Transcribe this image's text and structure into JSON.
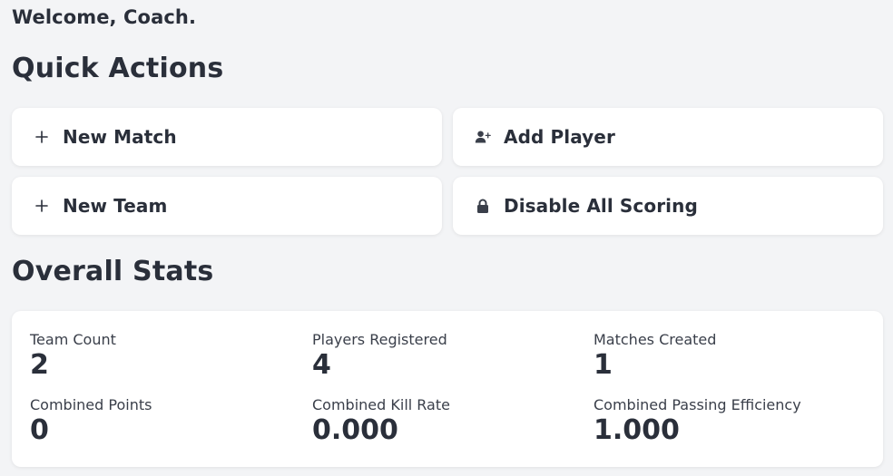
{
  "welcome": "Welcome, Coach.",
  "quick_actions": {
    "title": "Quick Actions",
    "items": [
      {
        "label": "New Match",
        "icon": "plus-icon"
      },
      {
        "label": "Add Player",
        "icon": "user-plus-icon"
      },
      {
        "label": "New Team",
        "icon": "plus-icon"
      },
      {
        "label": "Disable All Scoring",
        "icon": "lock-icon"
      }
    ]
  },
  "overall_stats": {
    "title": "Overall Stats",
    "items": [
      {
        "label": "Team Count",
        "value": "2"
      },
      {
        "label": "Players Registered",
        "value": "4"
      },
      {
        "label": "Matches Created",
        "value": "1"
      },
      {
        "label": "Combined Points",
        "value": "0"
      },
      {
        "label": "Combined Kill Rate",
        "value": "0.000"
      },
      {
        "label": "Combined Passing Efficiency",
        "value": "1.000"
      }
    ]
  },
  "colors": {
    "background": "#f3f4f6",
    "card": "#ffffff",
    "text": "#2a2f3a"
  }
}
